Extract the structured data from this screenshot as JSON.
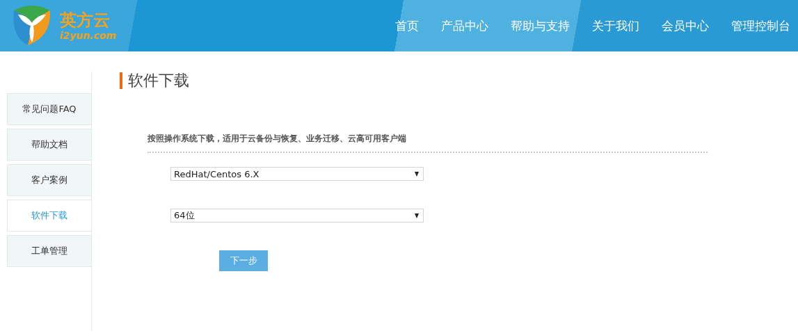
{
  "header": {
    "logo": {
      "name": "英方云",
      "domain": "i2yun.com"
    },
    "nav": [
      {
        "label": "首页"
      },
      {
        "label": "产品中心"
      },
      {
        "label": "帮助与支持"
      },
      {
        "label": "关于我们"
      },
      {
        "label": "会员中心"
      },
      {
        "label": "管理控制台"
      }
    ]
  },
  "sidebar": {
    "items": [
      {
        "label": "常见问题FAQ",
        "selected": false
      },
      {
        "label": "帮助文档",
        "selected": false
      },
      {
        "label": "客户案例",
        "selected": false
      },
      {
        "label": "软件下载",
        "selected": true
      },
      {
        "label": "工单管理",
        "selected": false
      }
    ]
  },
  "page_title": "软件下载",
  "description": "按照操作系统下载，适用于云备份与恢复、业务迁移、云高可用客户端",
  "selects": [
    {
      "value": "RedHat/Centos 6.X"
    },
    {
      "value": "64位"
    }
  ],
  "next_button": "下一步"
}
